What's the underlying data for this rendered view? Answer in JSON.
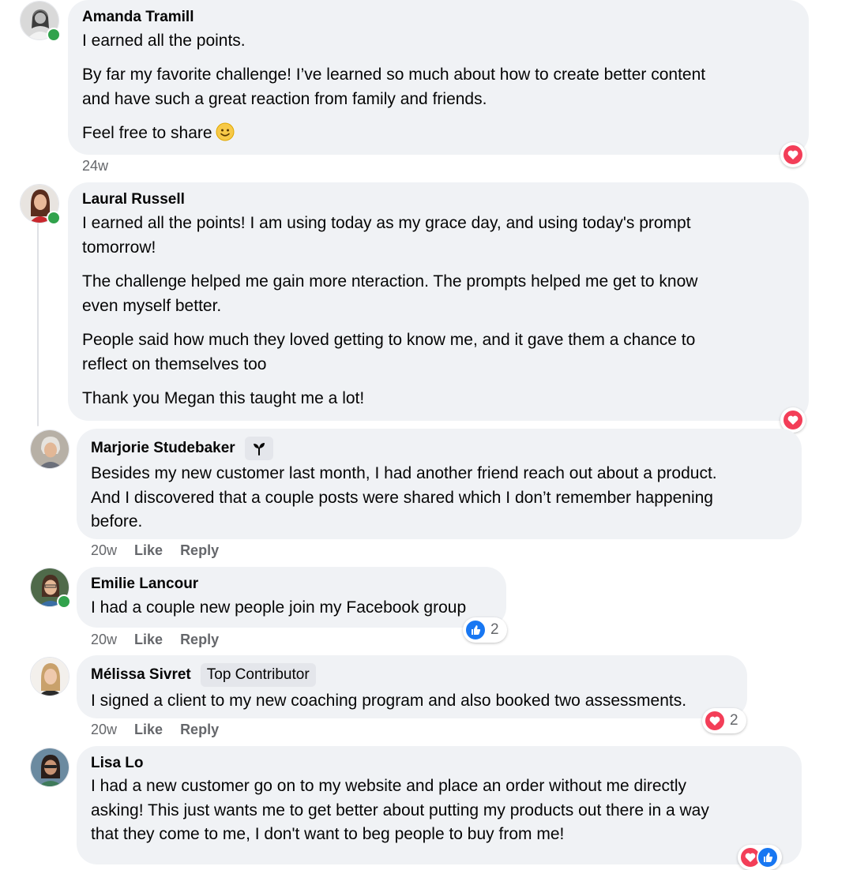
{
  "comments": [
    {
      "author": "Amanda Tramill",
      "paragraphs": [
        [
          "I earned all the points."
        ],
        [
          "By far my favorite challenge! I’ve learned so much about how to create better content",
          "and have such a great reaction from family and friends."
        ],
        [
          "Feel free to share"
        ]
      ],
      "emoji": "slightly-smiling-face-emoji",
      "time": "24w",
      "reaction_icon": "heart-reaction-icon"
    },
    {
      "author": "Laural Russell",
      "paragraphs": [
        [
          "I earned all the points! I am using today as my grace day, and using today's prompt",
          "tomorrow!"
        ],
        [
          "The challenge helped me gain more nteraction. The prompts helped me get to know",
          "even myself better."
        ],
        [
          "People said how much they loved getting to know me, and it gave them a chance to",
          "reflect on themselves too"
        ],
        [
          "Thank you Megan this taught me a lot!"
        ]
      ],
      "reaction_icon": "heart-reaction-icon"
    },
    {
      "author": "Marjorie Studebaker",
      "badge_icon": "new-member-sprout-icon",
      "paragraphs": [
        [
          "Besides my new customer last month, I had another friend reach out about a product.",
          "And I discovered that a couple posts were shared which I don’t remember happening",
          "before."
        ]
      ],
      "time": "20w",
      "like_label": "Like",
      "reply_label": "Reply"
    },
    {
      "author": "Emilie Lancour",
      "paragraphs": [
        [
          "I had a couple new people join my Facebook group"
        ]
      ],
      "time": "20w",
      "like_label": "Like",
      "reply_label": "Reply",
      "reaction_icon": "like-reaction-icon",
      "reaction_count": "2"
    },
    {
      "author": "Mélissa Sivret",
      "badge_text": "Top Contributor",
      "paragraphs": [
        [
          "I signed a client to my new coaching program and also booked two assessments."
        ]
      ],
      "time": "20w",
      "like_label": "Like",
      "reply_label": "Reply",
      "reaction_icon": "heart-reaction-icon",
      "reaction_count": "2"
    },
    {
      "author": "Lisa Lo",
      "paragraphs": [
        [
          "I had a new customer go on to my website and place an order without me directly",
          "asking! This just wants me to get better about putting my products out there in a way",
          "that they come to me, I don't want to beg people to buy from me!"
        ]
      ],
      "reaction_icons": [
        "heart-reaction-icon",
        "like-reaction-icon"
      ]
    }
  ],
  "colors": {
    "bubble": "#f0f2f5",
    "meta_text": "#65676b",
    "online": "#31a24c",
    "love": "#f33e58",
    "like": "#1877f2"
  }
}
